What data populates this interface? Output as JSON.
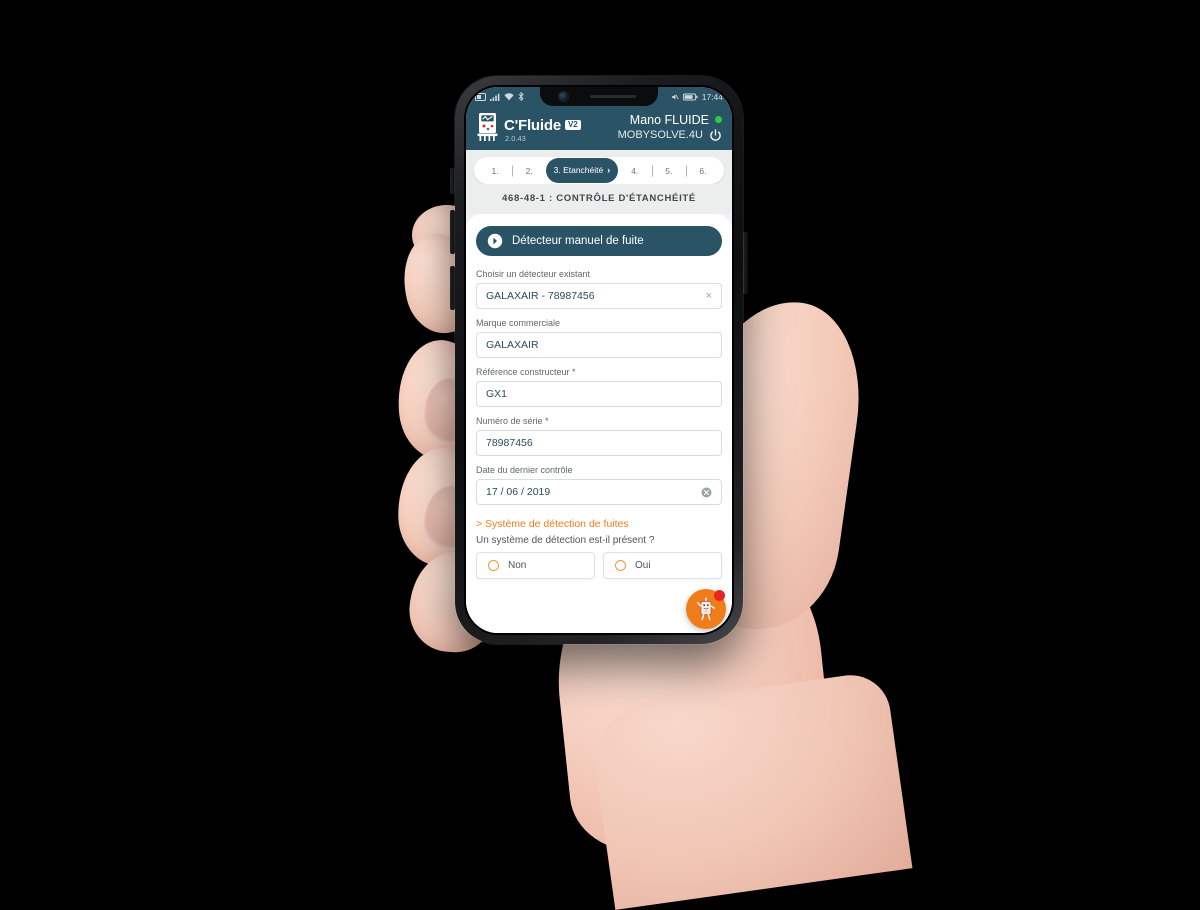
{
  "device": {
    "status_bar": {
      "time": "17:44",
      "left_icons": [
        "sim-card-icon",
        "signal-bars-icon",
        "wifi-icon",
        "bluetooth-icon"
      ],
      "right_icons": [
        "mute-icon",
        "battery-icon"
      ]
    }
  },
  "header": {
    "brand_name": "C'Fluide",
    "brand_badge": "V2",
    "version": "2.0.43",
    "user_name": "Mano FLUIDE",
    "user_org": "MOBYSOLVE.4U",
    "status_dot_color": "#2ecc40",
    "power_icon": "power-icon",
    "logo_icon": "measuring-device-icon"
  },
  "stepper": {
    "steps": [
      {
        "label": "1.",
        "active": false
      },
      {
        "label": "2.",
        "active": false
      },
      {
        "label": "3. Etanchéité",
        "active": true,
        "chevron": "›"
      },
      {
        "label": "4.",
        "active": false
      },
      {
        "label": "5.",
        "active": false
      },
      {
        "label": "6.",
        "active": false
      }
    ]
  },
  "page": {
    "title": "468-48-1 : CONTRÔLE D'ÉTANCHÉITÉ"
  },
  "section": {
    "header_label": "Détecteur manuel de fuite",
    "header_icon": "chevron-right-circle-icon",
    "header_color": "#2b5366"
  },
  "fields": [
    {
      "label": "Choisir un détecteur existant",
      "value": "GALAXAIR - 78987456",
      "placeholder": "",
      "clear": "×",
      "clear_icon": "close-x-icon",
      "name": "detector-select"
    },
    {
      "label": "Marque commerciale",
      "value": "GALAXAIR",
      "placeholder": "",
      "clear": "",
      "clear_icon": "",
      "name": "brand-field"
    },
    {
      "label": "Référence constructeur *",
      "value": "GX1",
      "placeholder": "",
      "clear": "",
      "clear_icon": "",
      "name": "manufacturer-ref-field"
    },
    {
      "label": "Numéro de série *",
      "value": "78987456",
      "placeholder": "",
      "clear": "",
      "clear_icon": "",
      "name": "serial-number-field"
    },
    {
      "label": "Date du dernier contrôle",
      "value": "17 / 06 / 2019",
      "placeholder": "",
      "clear": "",
      "clear_icon": "clear-circle-icon",
      "name": "last-control-date-field"
    }
  ],
  "subsection": {
    "title": "> Système de détection de fuites",
    "title_color": "#ef7d1a",
    "question": "Un système de détection est-il présent ?",
    "options": [
      {
        "label": "Non",
        "selected": false
      },
      {
        "label": "Oui",
        "selected": false
      }
    ]
  },
  "fab": {
    "icon": "assistant-robot-icon",
    "badge": "",
    "color": "#ef7d1a",
    "badge_color": "#e8261f"
  },
  "colors": {
    "brand_dark": "#2b5366",
    "accent_orange": "#ef7d1a",
    "page_bg": "#eceded",
    "text_dark": "#2b4a5c"
  }
}
